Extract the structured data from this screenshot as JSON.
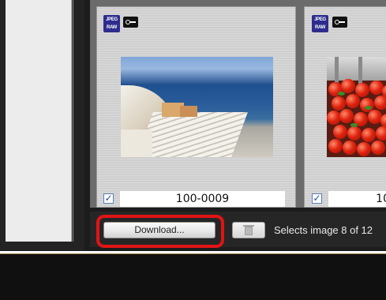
{
  "viewer": {
    "thumbnails": [
      {
        "badge_top": "JPEG",
        "badge_bottom": "RAW",
        "protect_icon": "key-icon",
        "checked": true,
        "check_glyph": "✓",
        "filename": "100-0009"
      },
      {
        "badge_top": "JPEG",
        "badge_bottom": "RAW",
        "protect_icon": "key-icon",
        "checked": true,
        "check_glyph": "✓",
        "filename": "10"
      }
    ]
  },
  "toolbar": {
    "download_label": "Download...",
    "trash_icon": "trash-icon",
    "status": "Selects image 8 of 12"
  },
  "colors": {
    "highlight": "#e01414",
    "badge": "#2d2d8e",
    "bottom_bar": "#262626"
  }
}
